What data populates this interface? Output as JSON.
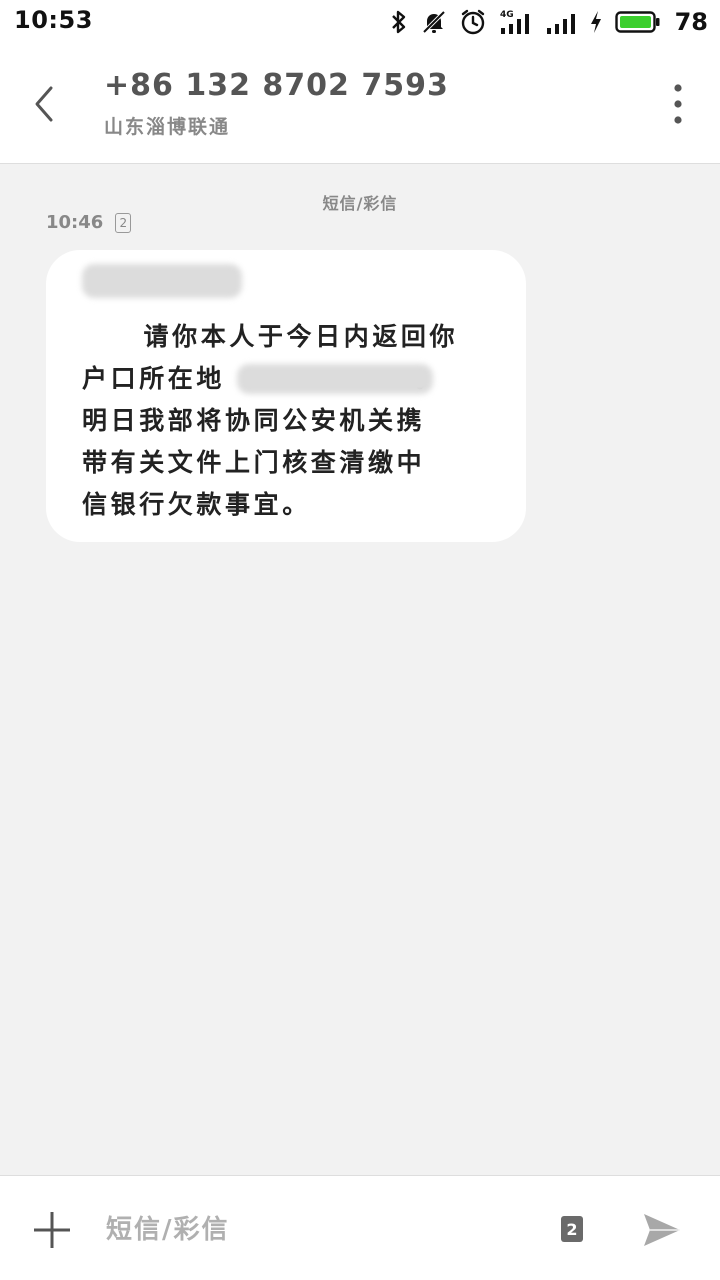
{
  "status_bar": {
    "time": "10:53",
    "network_label": "4G",
    "battery_level": "78",
    "icons": [
      "bluetooth-icon",
      "mute-icon",
      "alarm-icon",
      "signal-4g-icon",
      "signal-icon",
      "charging-icon",
      "battery-icon"
    ]
  },
  "header": {
    "contact_number": "+86 132 8702 7593",
    "carrier": "山东淄博联通",
    "icons": [
      "back-arrow-icon",
      "more-vertical-icon"
    ]
  },
  "conversation": {
    "type_label": "短信/彩信",
    "messages": [
      {
        "time": "10:46",
        "sim": "2",
        "lines": [
          "     请你本人于今日内返回你",
          "户口所在地",
          "明日我部将协同公安机关携",
          "带有关文件上门核查清缴中",
          "信银行欠款事宜。"
        ],
        "line2_tail": "。"
      }
    ]
  },
  "composer": {
    "placeholder": "短信/彩信",
    "sim": "2",
    "icons": [
      "plus-icon",
      "send-icon"
    ]
  },
  "colors": {
    "background": "#f2f2f2",
    "bubble": "#ffffff",
    "battery_fill": "#3ccf2e",
    "muted_text": "#888888"
  }
}
